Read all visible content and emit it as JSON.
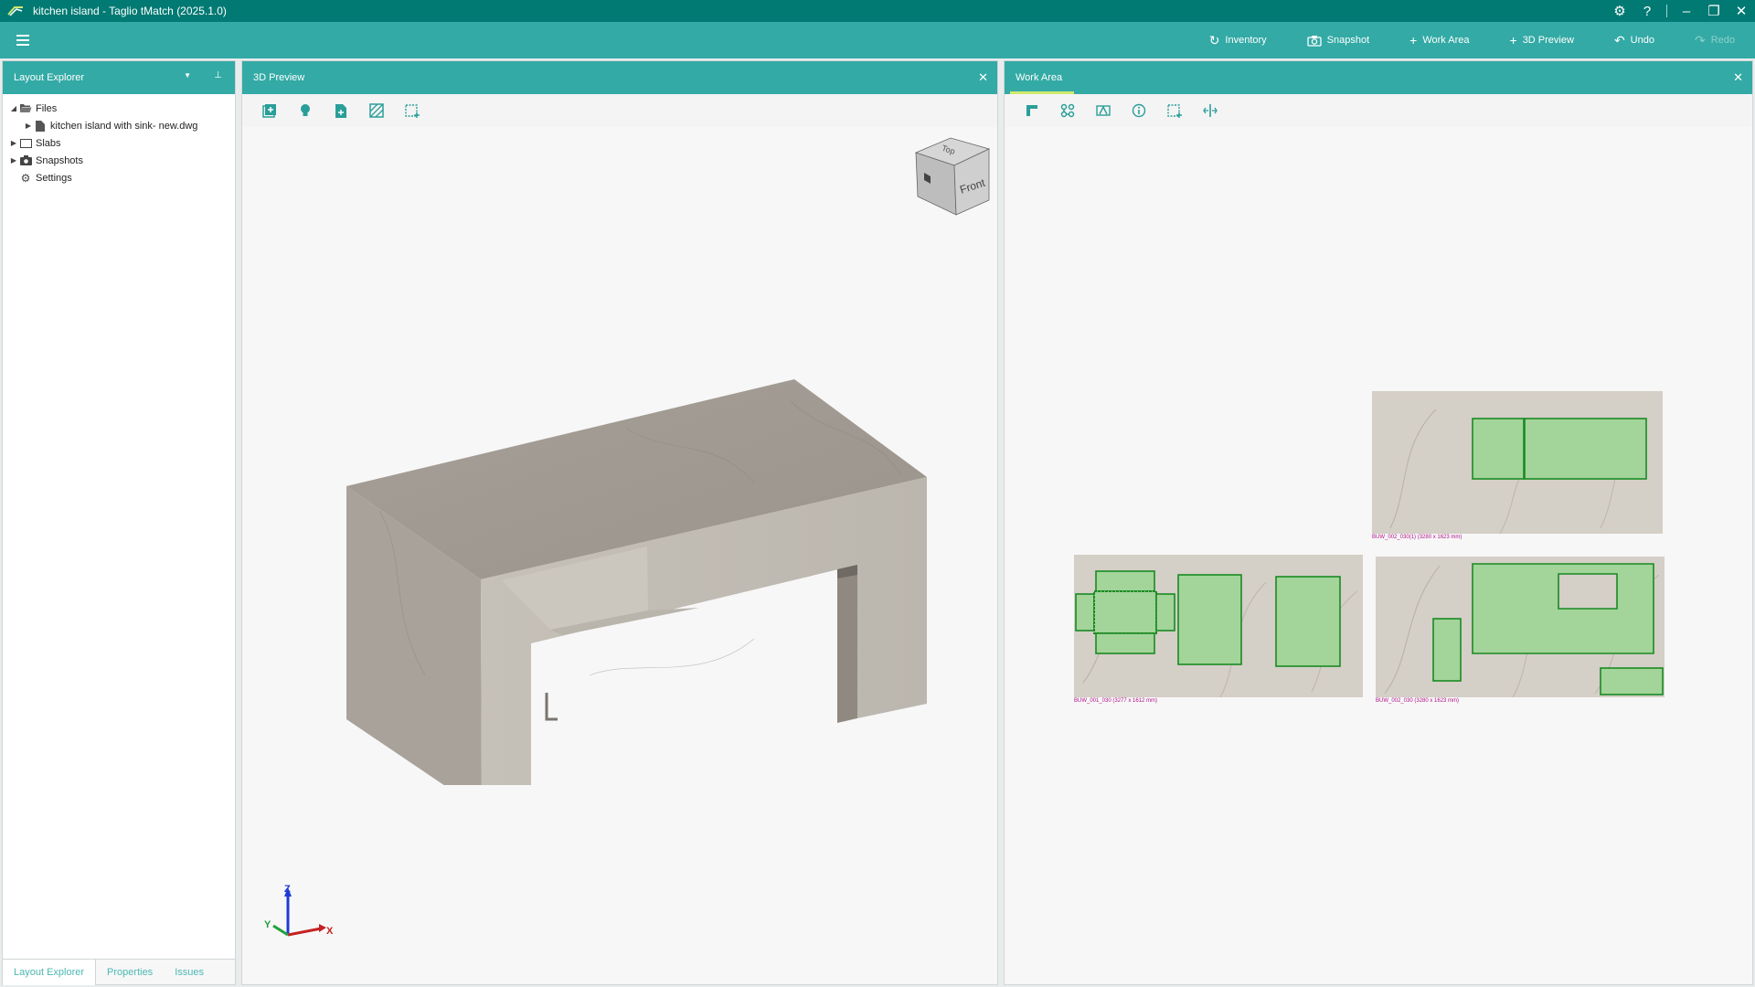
{
  "window": {
    "title": "kitchen island - Taglio tMatch (2025.1.0)"
  },
  "titlebar_icons": [
    "gear-icon",
    "help-icon",
    "minimize-icon",
    "restore-icon",
    "close-icon"
  ],
  "toolbar": {
    "inventory_label": "Inventory",
    "snapshot_label": "Snapshot",
    "work_area_label": "Work Area",
    "preview_label": "3D Preview",
    "undo_label": "Undo",
    "redo_label": "Redo"
  },
  "layout_explorer": {
    "title": "Layout Explorer",
    "tree": {
      "files_label": "Files",
      "file_name": "kitchen island with sink- new.dwg",
      "slabs_label": "Slabs",
      "snapshots_label": "Snapshots",
      "settings_label": "Settings"
    },
    "bottom_tabs": {
      "explorer": "Layout Explorer",
      "properties": "Properties",
      "issues": "Issues"
    }
  },
  "preview": {
    "title": "3D Preview",
    "viewcube": {
      "top": "Top",
      "front": "Front"
    },
    "axes": {
      "x": "X",
      "y": "Y",
      "z": "Z"
    }
  },
  "work_area": {
    "title": "Work Area",
    "slabs": [
      {
        "label": "BUW_002_030(1) (3280 x 1623 mm)"
      },
      {
        "label": "BUW_001_030 (3277 x 1612 mm)"
      },
      {
        "label": "BUW_002_030 (3280 x 1623 mm)"
      }
    ]
  },
  "colors": {
    "titlebar": "#007a73",
    "toolbar": "#33aaa5",
    "piece_fill": "#a3d49a",
    "piece_stroke": "#1a8a22",
    "slab_label": "#b0108a"
  }
}
